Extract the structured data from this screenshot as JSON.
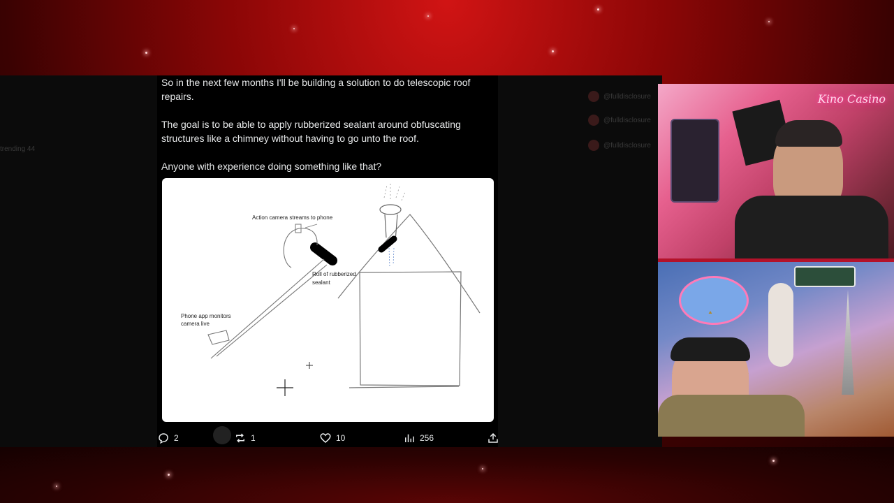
{
  "tweet": {
    "paragraphs": [
      "So in the next few months I'll be building a solution to do telescopic roof repairs.",
      "The goal is to be able to apply rubberized sealant around obfuscating structures like a chimney without having to go unto the roof.",
      "Anyone with experience doing something like that?"
    ],
    "sketch_labels": {
      "camera": "Action camera streams to phone",
      "roll": "Roll of rubberized sealant",
      "phone": "Phone app monitors camera live"
    },
    "actions": {
      "replies": "2",
      "reposts": "1",
      "likes": "10",
      "views": "256"
    }
  },
  "overlay": {
    "brand": "Kino Casino"
  },
  "background": {
    "ghost_left": "trending 44",
    "ghost_right": [
      "@fulldisclosure",
      "@fulldisclosure",
      "@fulldisclosure"
    ]
  },
  "colors": {
    "accent_red": "#b3122a",
    "neon_pink": "#ff2a8a"
  }
}
